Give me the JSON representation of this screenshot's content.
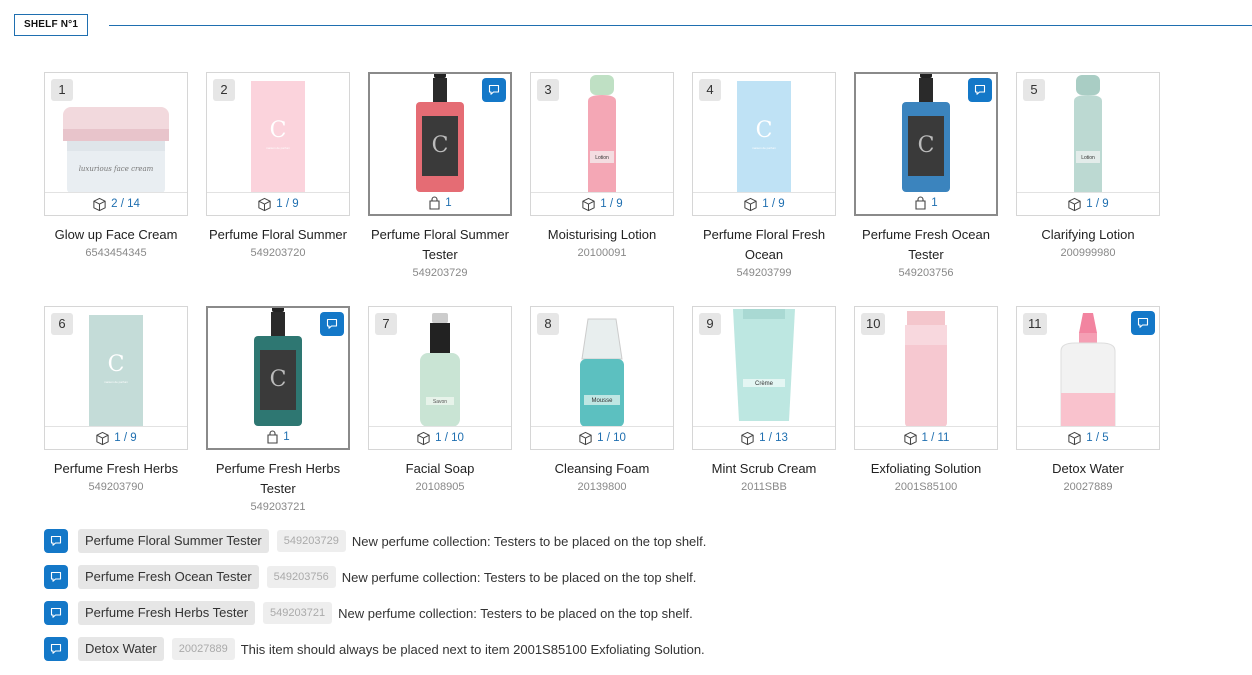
{
  "shelf": {
    "tag": "SHELF N°1"
  },
  "colors": {
    "accent": "#1478c8",
    "line": "#1f6fb0"
  },
  "products_row1": [
    {
      "num": "1",
      "stock": "2 / 14",
      "name": "Glow up Face Cream",
      "sku": "6543454345",
      "kind": "jar",
      "tester": false,
      "comment": false
    },
    {
      "num": "2",
      "stock": "1 / 9",
      "name": "Perfume Floral Summer",
      "sku": "549203720",
      "kind": "box-pink",
      "tester": false,
      "comment": false
    },
    {
      "num": "",
      "stock": "1",
      "name": "Perfume Floral Summer Tester",
      "sku": "549203729",
      "kind": "bottle-red",
      "tester": true,
      "comment": true
    },
    {
      "num": "3",
      "stock": "1 / 9",
      "name": "Moisturising Lotion",
      "sku": "20100091",
      "kind": "lotion-pink",
      "tester": false,
      "comment": false
    },
    {
      "num": "4",
      "stock": "1 / 9",
      "name": "Perfume Floral Fresh Ocean",
      "sku": "549203799",
      "kind": "box-blue",
      "tester": false,
      "comment": false
    },
    {
      "num": "",
      "stock": "1",
      "name": "Perfume Fresh Ocean Tester",
      "sku": "549203756",
      "kind": "bottle-blue",
      "tester": true,
      "comment": true
    },
    {
      "num": "5",
      "stock": "1 / 9",
      "name": "Clarifying Lotion",
      "sku": "200999980",
      "kind": "lotion-green",
      "tester": false,
      "comment": false
    }
  ],
  "products_row2": [
    {
      "num": "6",
      "stock": "1 / 9",
      "name": "Perfume Fresh Herbs",
      "sku": "549203790",
      "kind": "box-green",
      "tester": false,
      "comment": false
    },
    {
      "num": "",
      "stock": "1",
      "name": "Perfume Fresh Herbs Tester",
      "sku": "549203721",
      "kind": "bottle-green",
      "tester": true,
      "comment": true
    },
    {
      "num": "7",
      "stock": "1 / 10",
      "name": "Facial Soap",
      "sku": "20108905",
      "kind": "pump",
      "tester": false,
      "comment": false
    },
    {
      "num": "8",
      "stock": "1 / 10",
      "name": "Cleansing Foam",
      "sku": "20139800",
      "kind": "foam",
      "tester": false,
      "comment": false
    },
    {
      "num": "9",
      "stock": "1 / 13",
      "name": "Mint Scrub Cream",
      "sku": "2011SBB",
      "kind": "tube",
      "tester": false,
      "comment": false
    },
    {
      "num": "10",
      "stock": "1 / 11",
      "name": "Exfoliating Solution",
      "sku": "2001S85100",
      "kind": "pink-bottle",
      "tester": false,
      "comment": false
    },
    {
      "num": "11",
      "stock": "1 / 5",
      "name": "Detox Water",
      "sku": "20027889",
      "kind": "dropper",
      "tester": false,
      "comment": true
    }
  ],
  "notes": [
    {
      "name": "Perfume Floral Summer Tester",
      "sku": "549203729",
      "text": "New perfume collection: Testers to be placed on the top shelf."
    },
    {
      "name": "Perfume Fresh Ocean Tester",
      "sku": "549203756",
      "text": "New perfume collection: Testers to be placed on the top shelf."
    },
    {
      "name": "Perfume Fresh Herbs Tester",
      "sku": "549203721",
      "text": "New perfume collection: Testers to be placed on the top shelf."
    },
    {
      "name": "Detox Water",
      "sku": "20027889",
      "text": "This item should always be placed next to item 2001S85100 Exfoliating Solution."
    }
  ]
}
